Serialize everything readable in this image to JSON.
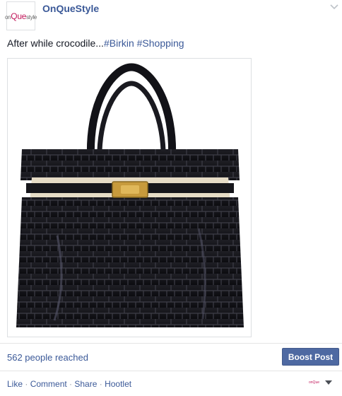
{
  "post": {
    "page_name": "OnQueStyle",
    "avatar_logo": {
      "prefix": "on",
      "accent": "Que",
      "suffix": "style"
    },
    "text_main": "After while crocodile...",
    "hashtags": [
      "#Birkin",
      " #Shopping"
    ],
    "photo_alt": "Black crocodile Birkin handbag",
    "reach": "562 people reached",
    "boost_label": "Boost Post",
    "actions": [
      "Like",
      "Comment",
      "Share",
      "Hootlet"
    ],
    "action_separator": " · ",
    "mini_logo": "onQue"
  },
  "colors": {
    "link": "#3b5998",
    "boost_bg": "#4e69a2",
    "accent": "#c2185b"
  },
  "icons": {
    "post_menu": "chevron-down-icon",
    "actions_menu": "caret-down-icon"
  }
}
